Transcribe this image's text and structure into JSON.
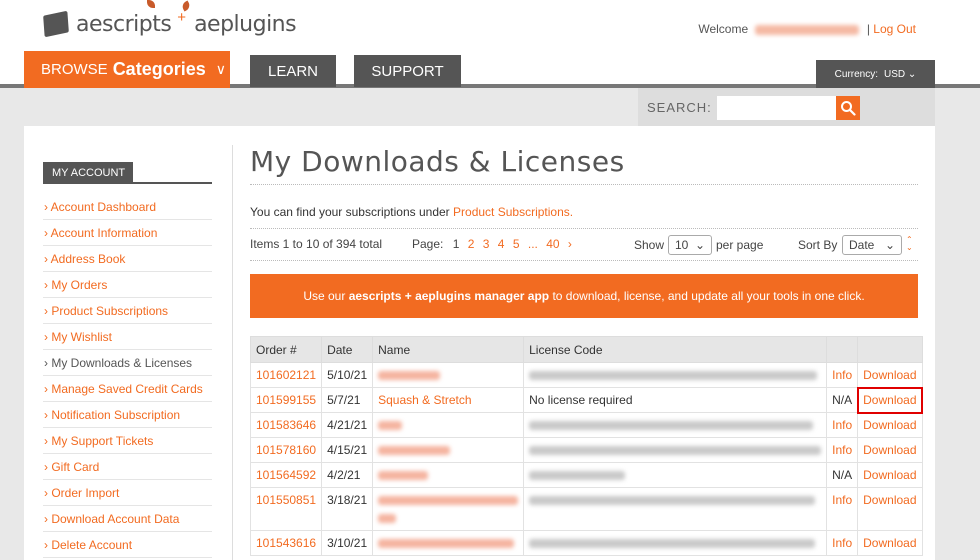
{
  "header": {
    "logo_left": "aescripts",
    "logo_plus": "+",
    "logo_right": "aeplugins",
    "welcome_label": "Welcome",
    "separator": "|",
    "logout_label": "Log Out"
  },
  "nav": {
    "browse_prefix": "BROWSE",
    "browse_bold": "Categories",
    "browse_chevron": "∨",
    "tabs": [
      {
        "label": "LEARN"
      },
      {
        "label": "SUPPORT"
      }
    ],
    "currency_label": "Currency:",
    "currency_value": "USD ⌄"
  },
  "search": {
    "label": "SEARCH:",
    "placeholder": ""
  },
  "sidebar": {
    "title": "MY ACCOUNT",
    "items": [
      {
        "label": "› Account Dashboard"
      },
      {
        "label": "› Account Information"
      },
      {
        "label": "› Address Book"
      },
      {
        "label": "› My Orders"
      },
      {
        "label": "› Product Subscriptions"
      },
      {
        "label": "› My Wishlist"
      },
      {
        "label": "› My Downloads & Licenses"
      },
      {
        "label": "› Manage Saved Credit Cards"
      },
      {
        "label": "› Notification Subscription"
      },
      {
        "label": "› My Support Tickets"
      },
      {
        "label": "› Gift Card"
      },
      {
        "label": "› Order Import"
      },
      {
        "label": "› Download Account Data"
      },
      {
        "label": "› Delete Account"
      }
    ]
  },
  "main": {
    "title": "My Downloads & Licenses",
    "subs_text": "You can find your subscriptions under",
    "subs_link": "Product Subscriptions.",
    "items_summary": "Items 1 to 10 of 394 total",
    "page_label": "Page:",
    "pages": [
      "1",
      "2",
      "3",
      "4",
      "5",
      "...",
      "40",
      "›"
    ],
    "show_label": "Show",
    "show_value": "10",
    "per_page_label": "per page",
    "sort_label": "Sort By",
    "sort_value": "Date",
    "banner_pre": "Use our",
    "banner_bold": "aescripts + aeplugins manager app",
    "banner_post": "to download, license, and update all your tools in one click."
  },
  "table": {
    "headers": [
      "Order #",
      "Date",
      "Name",
      "License Code",
      "",
      ""
    ],
    "rows": [
      {
        "order": "101602121",
        "date": "5/10/21",
        "name": "",
        "license": "",
        "info": "Info",
        "download": "Download"
      },
      {
        "order": "101599155",
        "date": "5/7/21",
        "name": "Squash & Stretch",
        "license": "No license required",
        "info": "N/A",
        "download": "Download"
      },
      {
        "order": "101583646",
        "date": "4/21/21",
        "name": "",
        "license": "",
        "info": "Info",
        "download": "Download"
      },
      {
        "order": "101578160",
        "date": "4/15/21",
        "name": "",
        "license": "",
        "info": "Info",
        "download": "Download"
      },
      {
        "order": "101564592",
        "date": "4/2/21",
        "name": "",
        "license": "",
        "info": "N/A",
        "download": "Download"
      },
      {
        "order": "101550851",
        "date": "3/18/21",
        "name": "",
        "license": "",
        "info": "Info",
        "download": "Download"
      },
      {
        "order": "101543616",
        "date": "3/10/21",
        "name": "",
        "license": "",
        "info": "Info",
        "download": "Download"
      }
    ]
  },
  "colors": {
    "accent": "#f26b21",
    "nav_dark": "#555555",
    "highlight": "#e00000"
  }
}
